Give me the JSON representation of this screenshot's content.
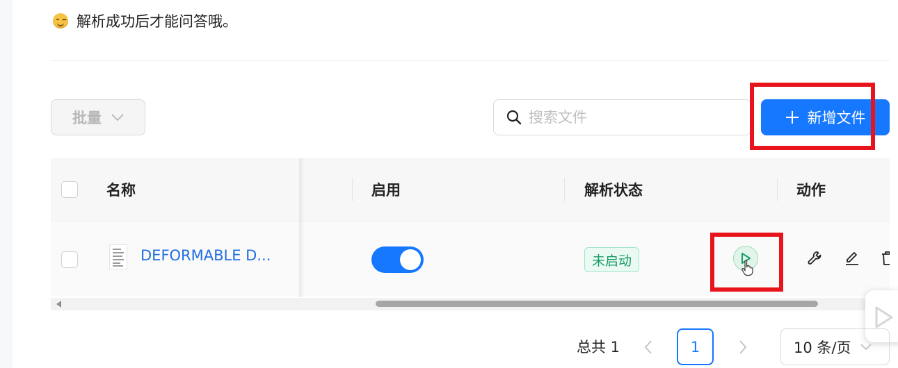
{
  "tip": {
    "emoji_icon": "smile-wink-face",
    "text": "解析成功后才能问答哦。"
  },
  "toolbar": {
    "batch_label": "批量",
    "search_placeholder": "搜索文件",
    "add_file_label": "新增文件"
  },
  "table": {
    "columns": {
      "name": "名称",
      "enabled": "启用",
      "parse_status": "解析状态",
      "actions": "动作"
    },
    "rows": [
      {
        "name": "DEFORMABLE D...",
        "enabled": true,
        "parse_status": "未启动"
      }
    ]
  },
  "pagination": {
    "total_label": "总共 1",
    "current_page": "1",
    "page_size": "10 条/页"
  },
  "colors": {
    "primary": "#1677ff",
    "highlight": "#e8141c",
    "status_green": "#1a9b67"
  }
}
